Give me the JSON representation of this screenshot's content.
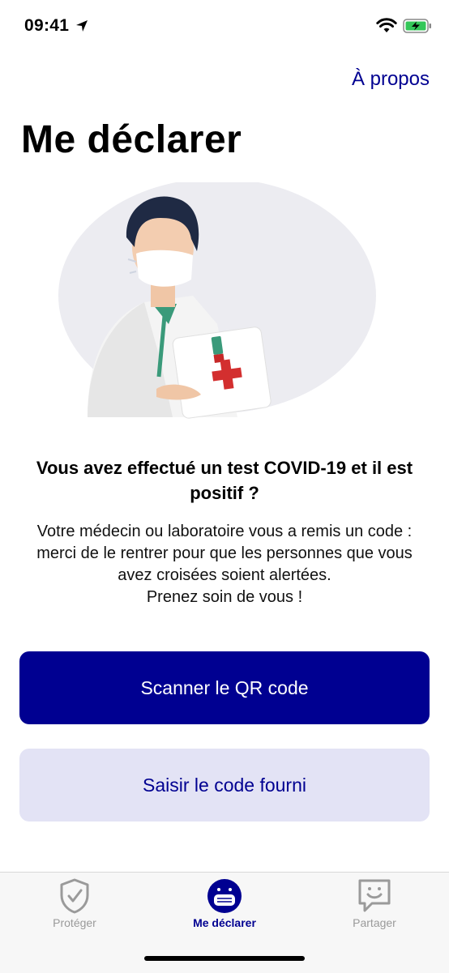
{
  "status_bar": {
    "time": "09:41"
  },
  "header": {
    "about_link": "À propos",
    "title": "Me déclarer"
  },
  "illustration": {
    "name": "doctor-illustration"
  },
  "content": {
    "question": "Vous avez effectué un test COVID-19 et il est positif ?",
    "explanation_lines": [
      "Votre médecin ou laboratoire vous a remis un code : merci de le rentrer pour que les personnes que vous avez croisées soient alertées.",
      "Prenez soin de vous !"
    ]
  },
  "buttons": {
    "scan_label": "Scanner le QR code",
    "enter_code_label": "Saisir le code fourni"
  },
  "tab_bar": {
    "tabs": [
      {
        "label": "Protéger",
        "icon": "shield-icon",
        "active": false
      },
      {
        "label": "Me déclarer",
        "icon": "mask-face-icon",
        "active": true
      },
      {
        "label": "Partager",
        "icon": "chat-smile-icon",
        "active": false
      }
    ]
  },
  "colors": {
    "brand": "#000091",
    "secondary_button_bg": "#e3e3f5",
    "tab_inactive": "#9a9a9a"
  }
}
